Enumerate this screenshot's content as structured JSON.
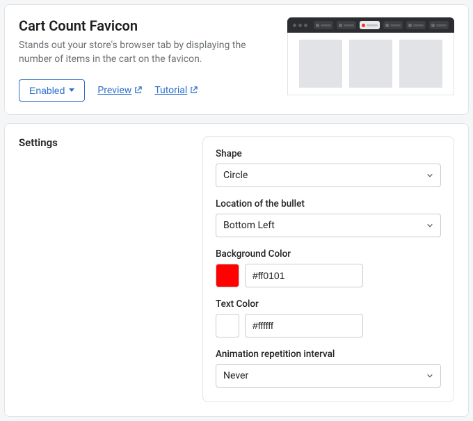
{
  "header": {
    "title": "Cart Count Favicon",
    "description": "Stands out your store's browser tab by displaying the number of items in the cart on the favicon.",
    "enable_label": "Enabled",
    "preview_label": "Preview",
    "tutorial_label": "Tutorial"
  },
  "settings": {
    "section_title": "Settings",
    "shape": {
      "label": "Shape",
      "value": "Circle"
    },
    "location": {
      "label": "Location of the bullet",
      "value": "Bottom Left"
    },
    "bg": {
      "label": "Background Color",
      "value": "#ff0101",
      "swatch": "#ff0101"
    },
    "text": {
      "label": "Text Color",
      "value": "#ffffff",
      "swatch": "#ffffff"
    },
    "anim": {
      "label": "Animation repetition interval",
      "value": "Never"
    }
  }
}
